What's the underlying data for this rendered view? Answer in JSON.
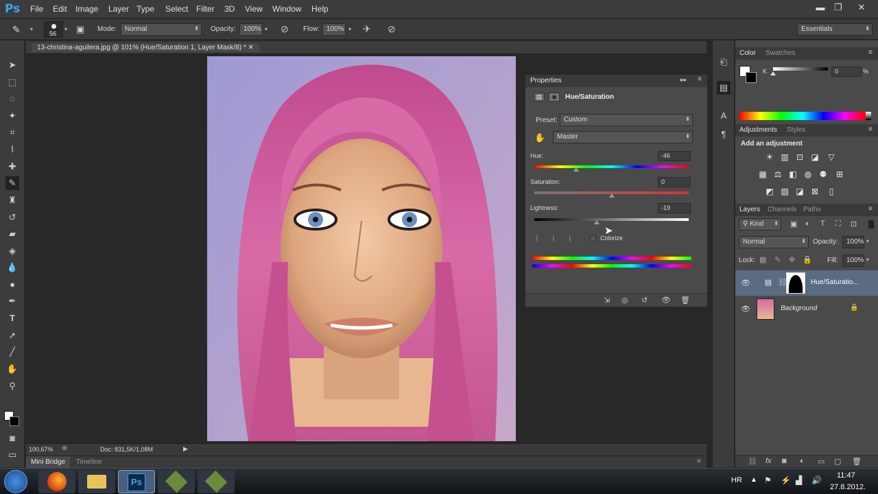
{
  "app": {
    "logo": "Ps"
  },
  "menu": [
    "File",
    "Edit",
    "Image",
    "Layer",
    "Type",
    "Select",
    "Filter",
    "3D",
    "View",
    "Window",
    "Help"
  ],
  "window_controls": {
    "minimize": "▬",
    "restore": "❐",
    "close": "✕"
  },
  "options": {
    "brush_size": "56",
    "mode_label": "Mode:",
    "mode_value": "Normal",
    "opacity_label": "Opacity:",
    "opacity_value": "100%",
    "flow_label": "Flow:",
    "flow_value": "100%",
    "workspace": "Essentials"
  },
  "document": {
    "tab_title": "13-christina-aguilera.jpg @ 101% (Hue/Saturation 1, Layer Mask/8) *",
    "zoom": "100,67%",
    "doc_size": "Doc: 831,5K/1,08M"
  },
  "bottom_tabs": [
    "Mini Bridge",
    "Timeline"
  ],
  "properties": {
    "title": "Properties",
    "adj_name": "Hue/Saturation",
    "preset_label": "Preset:",
    "preset_value": "Custom",
    "channel_value": "Master",
    "hue_label": "Hue:",
    "hue_value": "-46",
    "saturation_label": "Saturation:",
    "saturation_value": "0",
    "lightness_label": "Lightness:",
    "lightness_value": "-19",
    "colorize_label": "Colorize"
  },
  "color_panel": {
    "tabs": [
      "Color",
      "Swatches"
    ],
    "channel_label": "K",
    "k_value": "0",
    "k_unit": "%"
  },
  "adjustments_panel": {
    "tabs": [
      "Adjustments",
      "Styles"
    ],
    "heading": "Add an adjustment"
  },
  "layers_panel": {
    "tabs": [
      "Layers",
      "Channels",
      "Paths"
    ],
    "kind_label": "Kind",
    "blend_mode": "Normal",
    "opacity_label": "Opacity:",
    "opacity_value": "100%",
    "lock_label": "Lock:",
    "fill_label": "Fill:",
    "fill_value": "100%",
    "layers": [
      {
        "name": "Hue/Saturatio..."
      },
      {
        "name": "Background"
      }
    ]
  },
  "taskbar": {
    "language": "HR",
    "time": "11:47",
    "date": "27.8.2012."
  },
  "colors": {
    "app_bg": "#282828",
    "panel_bg": "#4a4a4a",
    "ps_blue": "#3fa3ef",
    "selected_layer": "#5a6b82"
  }
}
